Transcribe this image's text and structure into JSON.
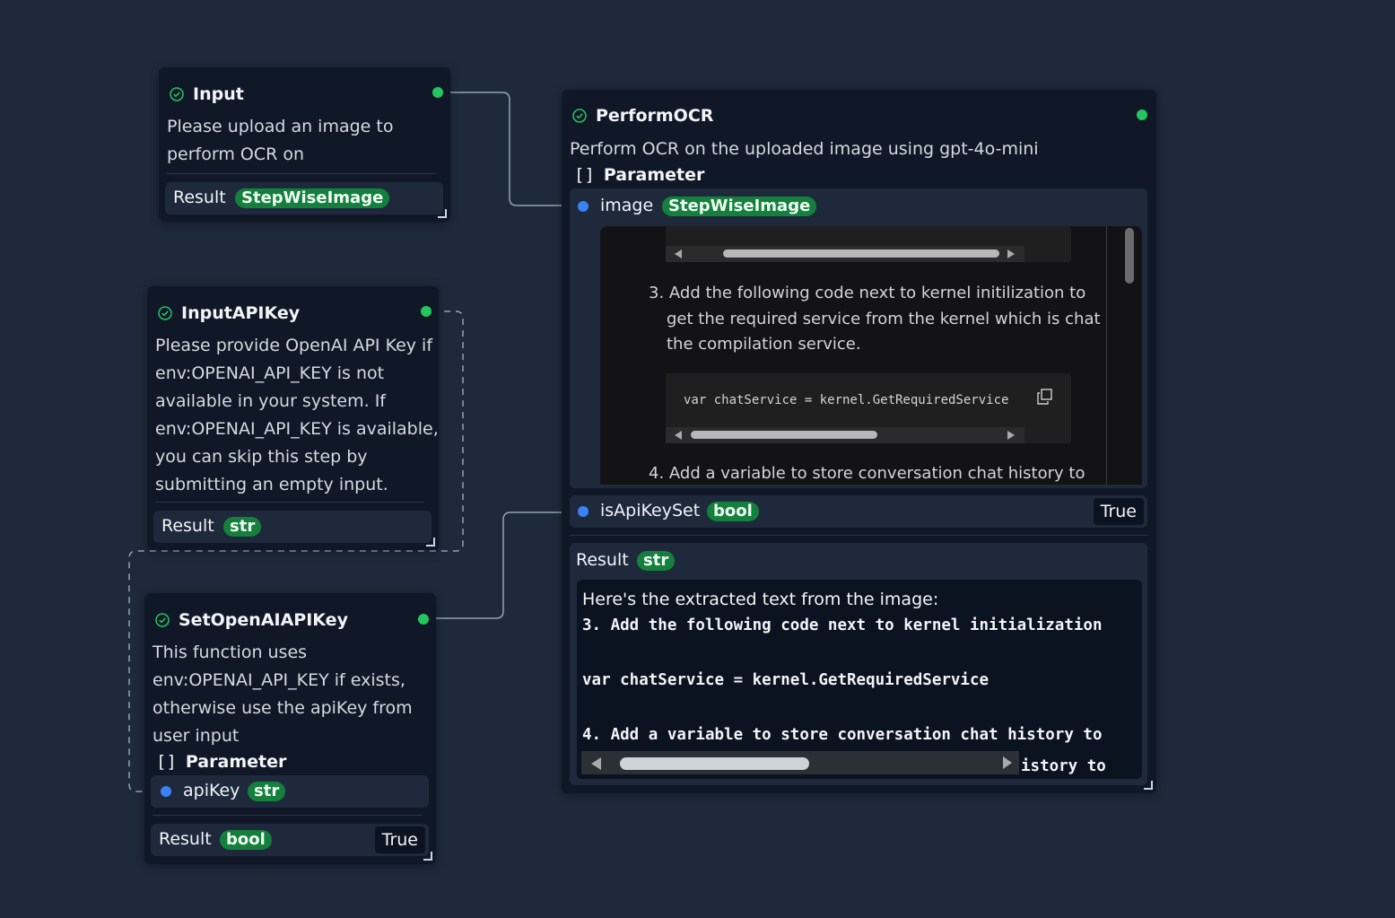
{
  "nodes": {
    "input": {
      "title": "Input",
      "description_lines": [
        "Please upload an image to",
        "perform OCR on"
      ],
      "result_label": "Result",
      "result_type": "StepWiseImage"
    },
    "input_api_key": {
      "title": "InputAPIKey",
      "description_lines": [
        "Please provide OpenAI API Key if",
        "env:OPENAI_API_KEY is not",
        "available in your system. If",
        "env:OPENAI_API_KEY is available,",
        "you can skip this step by",
        "submitting an empty input."
      ],
      "result_label": "Result",
      "result_type": "str"
    },
    "set_openai_api_key": {
      "title": "SetOpenAIAPIKey",
      "description_lines": [
        "This function uses",
        "env:OPENAI_API_KEY if exists,",
        "otherwise use the apiKey from",
        "user input"
      ],
      "parameter_header": "Parameter",
      "parameter_bracket": "[]",
      "param": {
        "name": "apiKey",
        "type": "str"
      },
      "result_label": "Result",
      "result_type": "bool",
      "result_value": "True"
    },
    "perform_ocr": {
      "title": "PerformOCR",
      "description": "Perform OCR on the uploaded image using gpt-4o-mini",
      "parameter_header": "Parameter",
      "parameter_bracket": "[]",
      "params": [
        {
          "name": "image",
          "type": "StepWiseImage"
        },
        {
          "name": "isApiKeySet",
          "type": "bool",
          "value": "True"
        }
      ],
      "image_preview": {
        "step3_lines": [
          "3. Add the following code next to kernel initilization to",
          "get the required service from the kernel which is chat",
          "the compilation service."
        ],
        "code": "var chatService = kernel.GetRequiredService",
        "step4_line": "4. Add a variable to store conversation chat history to"
      },
      "result_label": "Result",
      "result_type": "str",
      "result_lines": [
        "Here's the extracted text from the image:",
        "3. Add the following code next to kernel initialization",
        "var chatService = kernel.GetRequiredService",
        "4. Add a variable to store conversation chat history to"
      ],
      "result_overflow_text": "istory to"
    }
  },
  "colors": {
    "canvas": "#1e293b",
    "node": "#101828",
    "status_ok": "#22c55e",
    "input_port": "#3b82f6",
    "type_badge": "#15803d"
  }
}
